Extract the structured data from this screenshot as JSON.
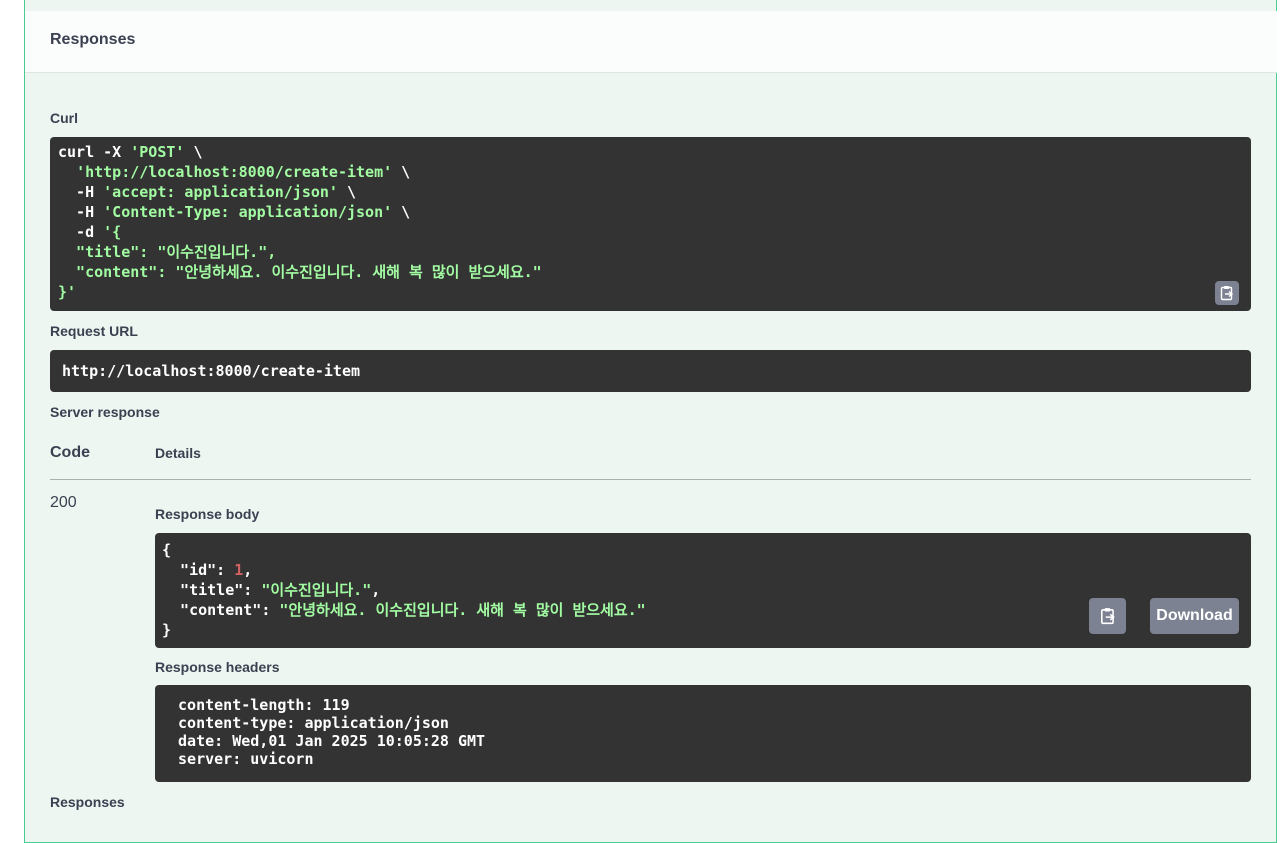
{
  "header": {
    "title": "Responses"
  },
  "curl": {
    "label": "Curl",
    "lines": [
      [
        {
          "t": "curl -X ",
          "c": "plain"
        },
        {
          "t": "'POST'",
          "c": "str"
        },
        {
          "t": " \\",
          "c": "plain"
        }
      ],
      [
        {
          "t": "  ",
          "c": "plain"
        },
        {
          "t": "'http://localhost:8000/create-item'",
          "c": "str"
        },
        {
          "t": " \\",
          "c": "plain"
        }
      ],
      [
        {
          "t": "  -H ",
          "c": "plain"
        },
        {
          "t": "'accept: application/json'",
          "c": "str"
        },
        {
          "t": " \\",
          "c": "plain"
        }
      ],
      [
        {
          "t": "  -H ",
          "c": "plain"
        },
        {
          "t": "'Content-Type: application/json'",
          "c": "str"
        },
        {
          "t": " \\",
          "c": "plain"
        }
      ],
      [
        {
          "t": "  -d ",
          "c": "plain"
        },
        {
          "t": "'{",
          "c": "str"
        }
      ],
      [
        {
          "t": "  \"title\": \"이수진입니다.\",",
          "c": "str"
        }
      ],
      [
        {
          "t": "  \"content\": \"안녕하세요. 이수진입니다. 새해 복 많이 받으세요.\"",
          "c": "str"
        }
      ],
      [
        {
          "t": "}'",
          "c": "str"
        }
      ]
    ]
  },
  "request_url": {
    "label": "Request URL",
    "value": "http://localhost:8000/create-item"
  },
  "server_response": {
    "label": "Server response",
    "code_header": "Code",
    "details_header": "Details",
    "code": "200",
    "body_label": "Response body",
    "body_lines": [
      [
        {
          "t": "{",
          "c": "plain"
        }
      ],
      [
        {
          "t": "  \"id\": ",
          "c": "plain"
        },
        {
          "t": "1",
          "c": "num"
        },
        {
          "t": ",",
          "c": "plain"
        }
      ],
      [
        {
          "t": "  \"title\": ",
          "c": "plain"
        },
        {
          "t": "\"이수진입니다.\"",
          "c": "str"
        },
        {
          "t": ",",
          "c": "plain"
        }
      ],
      [
        {
          "t": "  \"content\": ",
          "c": "plain"
        },
        {
          "t": "\"안녕하세요. 이수진입니다. 새해 복 많이 받으세요.\"",
          "c": "str"
        }
      ],
      [
        {
          "t": "}",
          "c": "plain"
        }
      ]
    ],
    "download_label": "Download",
    "headers_label": "Response headers",
    "headers_lines": [
      " content-length: 119",
      " content-type: application/json",
      " date: Wed,01 Jan 2025 10:05:28 GMT",
      " server: uvicorn"
    ]
  },
  "footer": {
    "label": "Responses"
  },
  "icons": {
    "copy": "clipboard-icon"
  },
  "colors": {
    "accent": "#49cc90",
    "code_bg": "#333333",
    "string": "#a2fca2",
    "number": "#d36363",
    "button": "#7d8293"
  }
}
